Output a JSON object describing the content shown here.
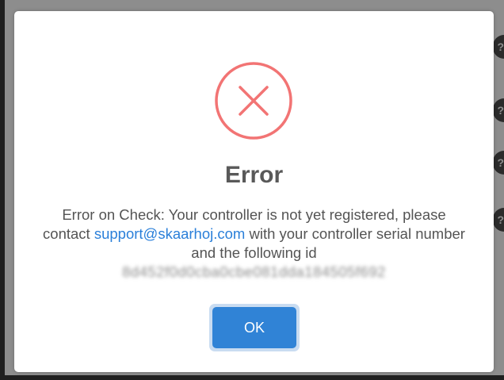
{
  "dialog": {
    "title": "Error",
    "message_part1": "Error on Check: Your controller is not yet registered, please contact ",
    "support_link": "support@skaarhoj.com",
    "message_part2": " with your controller serial number and the following id",
    "id_value": "8d452f0d0cba0cbe081dda184505f692",
    "ok_label": "OK"
  },
  "colors": {
    "error_ring": "#f27474",
    "link": "#2a7fd9",
    "button": "#3083d6",
    "title": "#595959"
  },
  "icons": {
    "error": "error-x-circle-icon",
    "background": "chat-bubble-icon"
  }
}
